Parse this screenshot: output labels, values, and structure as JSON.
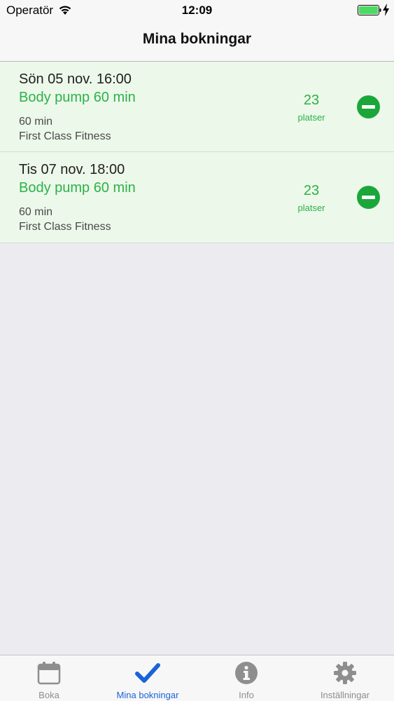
{
  "status_bar": {
    "carrier": "Operatör",
    "time": "12:09"
  },
  "nav": {
    "title": "Mina bokningar"
  },
  "bookings": [
    {
      "date": "Sön 05 nov. 16:00",
      "class_name": "Body pump 60 min",
      "duration": "60 min",
      "gym": "First Class Fitness",
      "spots_count": "23",
      "spots_label": "platser"
    },
    {
      "date": "Tis 07 nov. 18:00",
      "class_name": "Body pump 60 min",
      "duration": "60 min",
      "gym": "First Class Fitness",
      "spots_count": "23",
      "spots_label": "platser"
    }
  ],
  "tabs": [
    {
      "label": "Boka",
      "icon": "calendar-icon",
      "active": false
    },
    {
      "label": "Mina bokningar",
      "icon": "checkmark-icon",
      "active": true
    },
    {
      "label": "Info",
      "icon": "info-icon",
      "active": false
    },
    {
      "label": "Inställningar",
      "icon": "gear-icon",
      "active": false
    }
  ],
  "colors": {
    "accent_green": "#2cb14a",
    "remove_green": "#1ba63a",
    "row_background": "#ecf8e9",
    "active_tab_blue": "#1a63d8",
    "inactive_tab_gray": "#8e8e8e",
    "battery_green": "#4cd964"
  }
}
